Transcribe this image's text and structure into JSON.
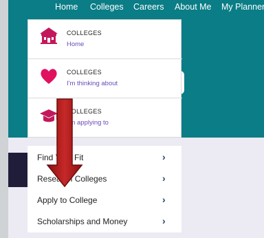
{
  "topnav": {
    "home": "Home",
    "colleges": "Colleges",
    "careers": "Careers",
    "about_me": "About Me",
    "my_planner": "My Planner"
  },
  "dropdown": {
    "items": [
      {
        "category": "COLLEGES",
        "label": "Home",
        "icon": "school-icon"
      },
      {
        "category": "COLLEGES",
        "label": "I'm thinking about",
        "icon": "heart-icon"
      },
      {
        "category": "COLLEGES",
        "label": "I'm applying to",
        "icon": "graduation-cap-icon"
      }
    ]
  },
  "menu": {
    "items": [
      {
        "label": "Find Your Fit"
      },
      {
        "label": "Research Colleges"
      },
      {
        "label": "Apply to College"
      },
      {
        "label": "Scholarships and Money"
      }
    ],
    "chevron": "›"
  },
  "colors": {
    "teal": "#0a7d86",
    "accent": "#c2185b",
    "sublabel": "#6a4bb8",
    "arrow": "#b31b1b"
  }
}
